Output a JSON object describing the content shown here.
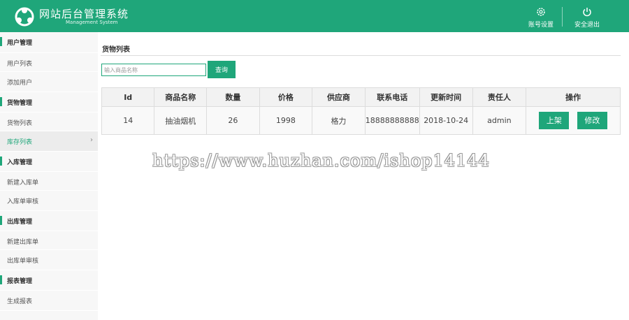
{
  "header": {
    "title": "网站后台管理系统",
    "subtitle": "Management System",
    "account_label": "账号设置",
    "logout_label": "安全退出",
    "brand_color": "#1fa67a"
  },
  "sidebar": {
    "rows": [
      {
        "type": "group",
        "label": "用户管理"
      },
      {
        "type": "item",
        "label": "用户列表"
      },
      {
        "type": "item",
        "label": "添加用户"
      },
      {
        "type": "group",
        "label": "货物管理"
      },
      {
        "type": "item",
        "label": "货物列表"
      },
      {
        "type": "item",
        "label": "库存列表",
        "active": true
      },
      {
        "type": "group",
        "label": "入库管理"
      },
      {
        "type": "item",
        "label": "新建入库单"
      },
      {
        "type": "item",
        "label": "入库单审核"
      },
      {
        "type": "group",
        "label": "出库管理"
      },
      {
        "type": "item",
        "label": "新建出库单"
      },
      {
        "type": "item",
        "label": "出库单审核"
      },
      {
        "type": "group",
        "label": "报表管理"
      },
      {
        "type": "item",
        "label": "生成报表"
      }
    ]
  },
  "main": {
    "section_title": "货物列表",
    "search_placeholder": "输入商品名称",
    "search_button": "查询",
    "table": {
      "headers": [
        "Id",
        "商品名称",
        "数量",
        "价格",
        "供应商",
        "联系电话",
        "更新时间",
        "责任人",
        "操作"
      ],
      "rows": [
        {
          "cells": [
            "14",
            "抽油烟机",
            "26",
            "1998",
            "格力",
            "18888888888",
            "2018-10-24",
            "admin"
          ],
          "actions": [
            "上架",
            "修改"
          ]
        }
      ]
    }
  },
  "watermark": "https://www.huzhan.com/ishop14144"
}
